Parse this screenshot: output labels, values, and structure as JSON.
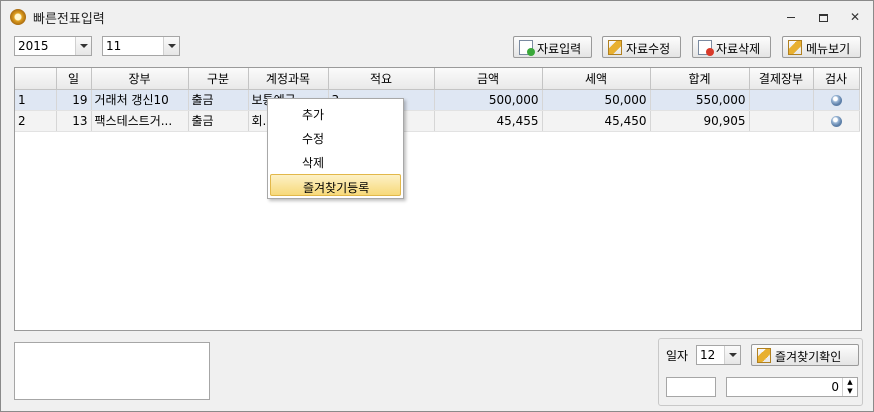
{
  "window": {
    "title": "빠른전표입력",
    "controls": [
      "minimize",
      "restore",
      "close"
    ]
  },
  "filters": {
    "year": "2015",
    "month": "11"
  },
  "toolbar": {
    "input_label": "자료입력",
    "edit_label": "자료수정",
    "delete_label": "자료삭제",
    "menu_label": "메뉴보기"
  },
  "grid": {
    "columns": [
      "일",
      "장부",
      "구분",
      "계정과목",
      "적요",
      "금액",
      "세액",
      "합계",
      "결제장부",
      "검사"
    ],
    "rows": [
      {
        "no": "1",
        "day": "19",
        "ledger": "거래처 갱신10",
        "type": "출금",
        "account": "보통예금",
        "memo": "3",
        "amount": "500,000",
        "tax": "50,000",
        "total": "550,000",
        "payment": "",
        "check": "check-icon"
      },
      {
        "no": "2",
        "day": "13",
        "ledger": "팩스테스트거...",
        "type": "출금",
        "account": "회...",
        "memo": "",
        "amount": "45,455",
        "tax": "45,450",
        "total": "90,905",
        "payment": "",
        "check": "check-icon"
      }
    ]
  },
  "context_menu": {
    "items": [
      "추가",
      "수정",
      "삭제",
      "즐겨찾기등록"
    ],
    "highlighted": "즐겨찾기등록"
  },
  "bottom": {
    "day_label": "일자",
    "day_value": "12",
    "confirm_label": "즐겨찾기확인",
    "small_field": "",
    "number_value": "0"
  },
  "colors": {
    "selected_row": "#dfe7f3",
    "menu_highlight": "#f7d97a"
  }
}
